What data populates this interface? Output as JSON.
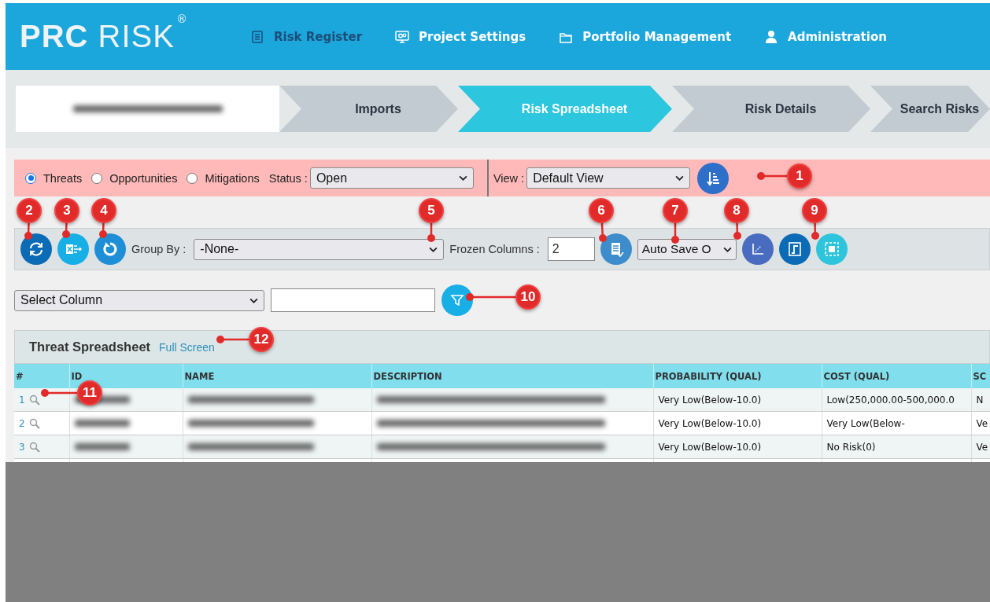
{
  "header": {
    "logo": "**PRC** RISK",
    "logo_mark": "®",
    "nav": [
      {
        "label": "Risk Register",
        "selected": true
      },
      {
        "label": "Project Settings",
        "selected": false
      },
      {
        "label": "Portfolio Management",
        "selected": false
      },
      {
        "label": "Administration",
        "selected": false
      }
    ]
  },
  "steps": [
    {
      "kind": "blurred",
      "selected": false
    },
    {
      "kind": "step",
      "label": "Imports",
      "selected": false
    },
    {
      "kind": "step",
      "label": "Risk Spreadsheet",
      "selected": true
    },
    {
      "kind": "step",
      "label": "Risk Details",
      "selected": false
    },
    {
      "kind": "step",
      "label": "Search Risks",
      "selected": false
    }
  ],
  "filters": {
    "risk_types": [
      {
        "label": "Threats",
        "selected": true
      },
      {
        "label": "Opportunities",
        "selected": false
      },
      {
        "label": "Mitigations",
        "selected": false
      }
    ],
    "status": {
      "label": "Status :",
      "value": "Open"
    },
    "view": {
      "label": "View :",
      "value": "Default View"
    }
  },
  "toolbar": {
    "group_by": {
      "label": "Group By :",
      "value": "-None-"
    },
    "frozen_columns": {
      "label": "Frozen Columns :",
      "value": "2"
    },
    "auto_save": {
      "value": "Auto Save O"
    }
  },
  "column_filter": {
    "column": "Select Column"
  },
  "spreadsheet": {
    "title": "Threat Spreadsheet",
    "full_screen_link": "Full Screen",
    "columns": [
      "#",
      "ID",
      "NAME",
      "DESCRIPTION",
      "PROBABILITY (QUAL)",
      "COST (QUAL)",
      "SC"
    ],
    "rows": [
      {
        "number": "1",
        "probability": "Very Low(Below-10.0)",
        "cost": "Low(250,000.00-500,000.0",
        "column_7": "N"
      },
      {
        "number": "2",
        "probability": "Very Low(Below-10.0)",
        "cost": "Very Low(Below-",
        "column_7": "Ve"
      },
      {
        "number": "3",
        "probability": "Very Low(Below-10.0)",
        "cost": "No Risk(0)",
        "column_7": "Ve"
      }
    ]
  },
  "callouts": [
    "1",
    "2",
    "3",
    "4",
    "5",
    "6",
    "7",
    "8",
    "9",
    "10",
    "11",
    "12"
  ]
}
